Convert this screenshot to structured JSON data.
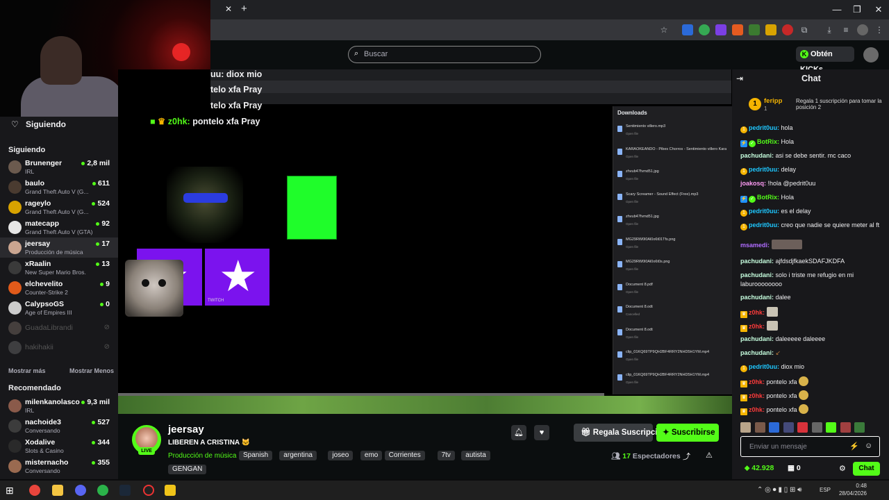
{
  "kick": {
    "search_placeholder": "Buscar",
    "kicks_button": "Obtén KICKs"
  },
  "sidebar": {
    "following_toggle": "Siguiendo",
    "following_heading": "Siguiendo",
    "following": [
      {
        "name": "Brunenger",
        "category": "IRL",
        "viewers": "2,8 mil",
        "color": "#6b5a4e"
      },
      {
        "name": "baulo",
        "category": "Grand Theft Auto V (G...",
        "viewers": "611",
        "color": "#4a3b30"
      },
      {
        "name": "rageylo",
        "category": "Grand Theft Auto V (G...",
        "viewers": "524",
        "color": "#d8a300"
      },
      {
        "name": "matecapp",
        "category": "Grand Theft Auto V (GTA)",
        "viewers": "92",
        "color": "#e6e6e6"
      },
      {
        "name": "jeersay",
        "category": "Producción de música",
        "viewers": "17",
        "color": "#caa590"
      },
      {
        "name": "xRaalin",
        "category": "New Super Mario Bros.",
        "viewers": "13",
        "color": "#3a3a3a"
      },
      {
        "name": "elchevelito",
        "category": "Counter-Strike 2",
        "viewers": "9",
        "color": "#e05a1a"
      },
      {
        "name": "CalypsoGS",
        "category": "Age of Empires III",
        "viewers": "0",
        "color": "#cccccc"
      }
    ],
    "offline": [
      {
        "name": "GuadaLibrandi",
        "color": "#8a7a70"
      },
      {
        "name": "hakihakii",
        "color": "#777777"
      }
    ],
    "show_more": "Mostrar más",
    "show_less": "Mostrar Menos",
    "recommended_heading": "Recomendado",
    "recommended": [
      {
        "name": "milenkanolasco",
        "category": "IRL",
        "viewers": "9,3 mil",
        "color": "#8a5a4a"
      },
      {
        "name": "nachoide3",
        "category": "Conversando",
        "viewers": "527",
        "color": "#3c3c3c"
      },
      {
        "name": "Xodalive",
        "category": "Slots & Casino",
        "viewers": "344",
        "color": "#2a2a2a"
      },
      {
        "name": "misternacho",
        "category": "Conversando",
        "viewers": "355",
        "color": "#9a6a50"
      }
    ]
  },
  "stream_overlay": {
    "lines": [
      "uu: diox mio",
      "telo xfa Pray",
      "telo xfa Pray"
    ],
    "last_user": "z0hk:",
    "last_msg": "pontelo xfa Pray",
    "twitch_label": "TWITCH",
    "downloads_title": "Downloads",
    "downloads": [
      {
        "name": "Sentimiento villero.mp3",
        "status": "Open file"
      },
      {
        "name": "KARAOKEANDO - Pibes Chorros - Sentimiento villero Karaoke.mp3",
        "status": "Open file"
      },
      {
        "name": "zhvub47fvmd51.jpg",
        "status": "Open file"
      },
      {
        "name": "Scary Screamer - Sound Effect (Free).mp3",
        "status": "Open file"
      },
      {
        "name": "zhvub47fvmd51.jpg",
        "status": "Open file"
      },
      {
        "name": "MG29RW0l0Al0o6t01Tfs.png",
        "status": "Open file"
      },
      {
        "name": "MG29RW0l0Al0o6t0s.png",
        "status": "Open file"
      },
      {
        "name": "Document 8.pdf",
        "status": "Open file"
      },
      {
        "name": "Document 8.odt",
        "status": "Cancelled"
      },
      {
        "name": "Document 8.odt",
        "status": "Open file"
      },
      {
        "name": "clip_01KQ69TP9QH2BF4RRY2NHD5H1YM.mp4",
        "status": "Open file"
      },
      {
        "name": "clip_01KQ69TP9QH2BF4RRY2NHD5H1YM.mp4",
        "status": "Open file"
      }
    ]
  },
  "stream_info": {
    "streamer": "jeersay",
    "live_badge": "LIVE",
    "title": "LIBEREN A CRISTINA 🐱",
    "category": "Producción de música",
    "tags": [
      "Spanish",
      "argentina",
      "joseo",
      "emo",
      "Corrientes",
      "7tv",
      "autista"
    ],
    "extra_tag": "GENGAN",
    "gift_button": "Regala Suscripciones",
    "subscribe_button": "Suscribirse",
    "viewer_count": "17",
    "viewer_label": "Espectadores"
  },
  "chat": {
    "title": "Chat",
    "pinned_user": "feripp",
    "pinned_rank": "1",
    "pinned_sub": "1",
    "pinned_msg": "Regala 1 suscripción para tomar la posición 2",
    "messages": [
      {
        "badge": "gold",
        "user": "pedrit0uu:",
        "color": "#1ec7ff",
        "text": "hola"
      },
      {
        "badge": "bot",
        "user": "BotRix:",
        "color": "#53fc18",
        "text": "Hola"
      },
      {
        "badge": "",
        "user": "pachudani:",
        "color": "#c7ffdf",
        "text": "asi se debe sentir. mc caco"
      },
      {
        "badge": "gold",
        "user": "pedrit0uu:",
        "color": "#1ec7ff",
        "text": "delay"
      },
      {
        "badge": "",
        "user": "joakosq:",
        "color": "#ff9cf5",
        "text": "!hola @pedrit0uu"
      },
      {
        "badge": "bot",
        "user": "BotRix:",
        "color": "#53fc18",
        "text": "Hola"
      },
      {
        "badge": "gold",
        "user": "pedrit0uu:",
        "color": "#1ec7ff",
        "text": "es el delay"
      },
      {
        "badge": "gold",
        "user": "pedrit0uu:",
        "color": "#1ec7ff",
        "text": "creo que nadie se quiere meter al ft"
      },
      {
        "badge": "",
        "user": "msamedi:",
        "color": "#b06cff",
        "text": ""
      },
      {
        "badge": "",
        "user": "pachudani:",
        "color": "#c7ffdf",
        "text": "ajfdsdjfkaekSDAFJKDFA"
      },
      {
        "badge": "",
        "user": "pachudani:",
        "color": "#c7ffdf",
        "text": "solo i triste me refugio en mi laburoooooooo"
      },
      {
        "badge": "",
        "user": "pachudani:",
        "color": "#c7ffdf",
        "text": "dalee"
      },
      {
        "badge": "crown",
        "user": "z0hk:",
        "color": "#ff3b3b",
        "text": ""
      },
      {
        "badge": "crown",
        "user": "z0hk:",
        "color": "#ff3b3b",
        "text": ""
      },
      {
        "badge": "",
        "user": "pachudani:",
        "color": "#c7ffdf",
        "text": "daleeeee daleeee"
      },
      {
        "badge": "",
        "user": "pachudani:",
        "color": "#c7ffdf",
        "text": ""
      },
      {
        "badge": "gold",
        "user": "pedrit0uu:",
        "color": "#1ec7ff",
        "text": "diox mio"
      },
      {
        "badge": "crown",
        "user": "z0hk:",
        "color": "#ff3b3b",
        "text": "pontelo xfa"
      },
      {
        "badge": "crown",
        "user": "z0hk:",
        "color": "#ff3b3b",
        "text": "pontelo xfa"
      },
      {
        "badge": "crown",
        "user": "z0hk:",
        "color": "#ff3b3b",
        "text": "pontelo xfa"
      }
    ],
    "input_placeholder": "Enviar un mensaje",
    "points": "42.928",
    "store_count": "0",
    "send_button": "Chat"
  },
  "taskbar": {
    "lang": "ESP",
    "time": "0:48",
    "date": "28/04/2026"
  }
}
